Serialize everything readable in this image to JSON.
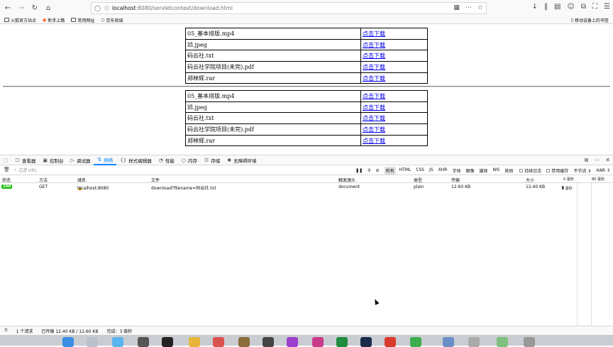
{
  "browser": {
    "url_host": "localhost",
    "url_path": ":8080/servletcontext/download.html",
    "bookmarks": [
      "火狐官方站点",
      "新手上路",
      "常用网址",
      "京东商城"
    ],
    "mobile_bookmarks": "移动设备上的书签"
  },
  "page": {
    "tables": [
      {
        "rows": [
          {
            "name": "05_基本排版.mp4",
            "link": "点击下载"
          },
          {
            "name": "lfl.jpeg",
            "link": "点击下载"
          },
          {
            "name": "码云社.txt",
            "link": "点击下载"
          },
          {
            "name": "码云社学院项目(未完).pdf",
            "link": "点击下载"
          },
          {
            "name": "郑林辉.rar",
            "link": "点击下载"
          }
        ]
      },
      {
        "rows": [
          {
            "name": "05_基本排版.mp4",
            "link": "点击下载"
          },
          {
            "name": "lfl.jpeg",
            "link": "点击下载"
          },
          {
            "name": "码云社.txt",
            "link": "点击下载"
          },
          {
            "name": "码云社学院项目(未完).pdf",
            "link": "点击下载"
          },
          {
            "name": "郑林辉.rar",
            "link": "点击下载"
          }
        ]
      }
    ]
  },
  "devtools": {
    "tabs": [
      {
        "label": "查看器",
        "icon": "inspector-icon"
      },
      {
        "label": "控制台",
        "icon": "console-icon"
      },
      {
        "label": "调试器",
        "icon": "debugger-icon"
      },
      {
        "label": "网络",
        "icon": "network-icon",
        "active": true
      },
      {
        "label": "样式编辑器",
        "icon": "style-editor-icon"
      },
      {
        "label": "性能",
        "icon": "performance-icon"
      },
      {
        "label": "内存",
        "icon": "memory-icon"
      },
      {
        "label": "存储",
        "icon": "storage-icon"
      },
      {
        "label": "无障碍环境",
        "icon": "accessibility-icon"
      }
    ],
    "filter_placeholder": "过滤 URL",
    "type_filters": [
      "所有",
      "HTML",
      "CSS",
      "JS",
      "XHR",
      "字体",
      "图像",
      "媒体",
      "WS",
      "其他"
    ],
    "persist_logs": "持续日志",
    "disable_cache": "禁用缓存",
    "throttle": "不节流",
    "har": "HAR",
    "columns": {
      "status": "状态",
      "method": "方法",
      "domain": "域名",
      "file": "文件",
      "cause": "触发源头",
      "type": "类型",
      "transferred": "传输",
      "size": "大小",
      "timeline": "0 毫秒",
      "timeline2": "80 毫秒"
    },
    "request": {
      "status": "200",
      "method": "GET",
      "domain": "localhost:8080",
      "file": "download?filename=码云社.txt",
      "cause": "document",
      "type": "plain",
      "transferred": "12.60 KB",
      "size": "12.40 KB",
      "timing": "3 毫秒"
    },
    "summary": {
      "requests": "1 个请求",
      "transferred": "已传输 12.40 KB / 12.60 KB",
      "finish": "完成：3 毫秒"
    }
  }
}
